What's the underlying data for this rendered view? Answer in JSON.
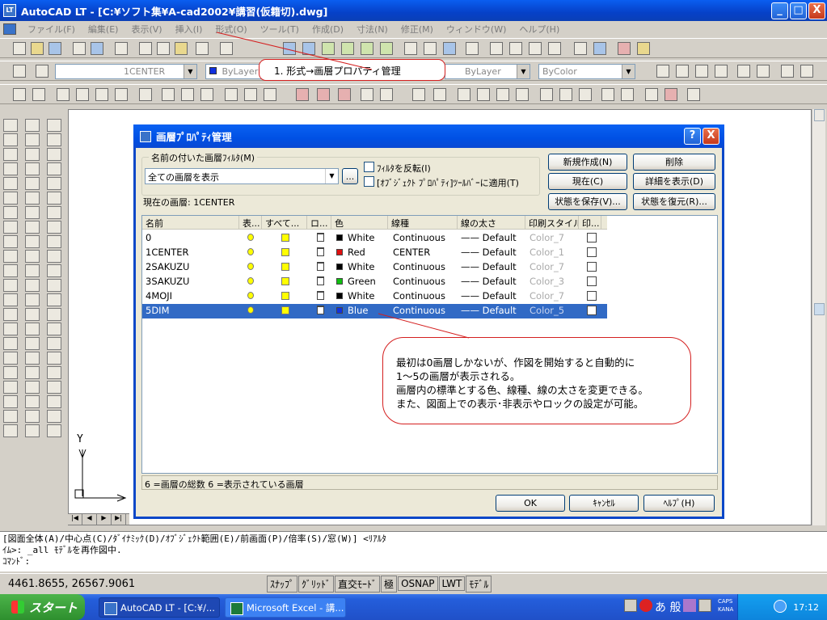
{
  "window": {
    "title": "AutoCAD LT - [C:¥ソフト集¥A-cad2002¥講習(仮籍切).dwg]",
    "controls": [
      "_",
      "□",
      "X"
    ]
  },
  "menubar": [
    "ファイル(F)",
    "編集(E)",
    "表示(V)",
    "挿入(I)",
    "形式(O)",
    "ツール(T)",
    "作成(D)",
    "寸法(N)",
    "修正(M)",
    "ウィンドウ(W)",
    "ヘルプ(H)"
  ],
  "toolbar2": {
    "layer_combo": "1CENTER",
    "color_combo": "ByLayer",
    "linetype_combo": "ByLayer",
    "plotstyle_combo": "ByColor"
  },
  "callout1": {
    "text": "1. 形式→画層プロパティ管理"
  },
  "callout2": {
    "lines": [
      "最初は0画層しかないが、作図を開始すると自動的に",
      "1〜5の画層が表示される。",
      "画層内の標準とする色、線種、線の太さを変更できる。",
      "また、図面上での表示･非表示やロックの設定が可能。"
    ]
  },
  "dialog": {
    "title": "画層ﾌﾟﾛﾊﾟﾃｨ管理",
    "help_btn": "?",
    "close_btn": "X",
    "filter_group_label": "名前の付いた画層ﾌｨﾙﾀ(M)",
    "filter_value": "全ての画層を表示",
    "filter_more": "...",
    "invert_filter": "ﾌｨﾙﾀを反転(I)",
    "apply_toolbar": "[ｵﾌﾞｼﾞｪｸﾄ ﾌﾟﾛﾊﾟﾃｨ]ﾂｰﾙﾊﾞｰに適用(T)",
    "buttons": {
      "new": "新規作成(N)",
      "delete": "削除",
      "current": "現在(C)",
      "show_details": "詳細を表示(D)",
      "save_state": "状態を保存(V)...",
      "restore_state": "状態を復元(R)..."
    },
    "current_layer_label": "現在の画層: 1CENTER",
    "columns": [
      "名前",
      "表...",
      "すべて...",
      "ロ...",
      "色",
      "線種",
      "線の太さ",
      "印刷スタイル",
      "印..."
    ],
    "layers": [
      {
        "name": "0",
        "color_name": "White",
        "color": "#000000",
        "linetype": "Continuous",
        "lineweight": "—— Default",
        "plotstyle": "Color_7"
      },
      {
        "name": "1CENTER",
        "color_name": "Red",
        "color": "#e01010",
        "linetype": "CENTER",
        "lineweight": "—— Default",
        "plotstyle": "Color_1"
      },
      {
        "name": "2SAKUZU",
        "color_name": "White",
        "color": "#000000",
        "linetype": "Continuous",
        "lineweight": "—— Default",
        "plotstyle": "Color_7"
      },
      {
        "name": "3SAKUZU",
        "color_name": "Green",
        "color": "#10c010",
        "linetype": "Continuous",
        "lineweight": "—— Default",
        "plotstyle": "Color_3"
      },
      {
        "name": "4MOJI",
        "color_name": "White",
        "color": "#000000",
        "linetype": "Continuous",
        "lineweight": "—— Default",
        "plotstyle": "Color_7"
      },
      {
        "name": "5DIM",
        "color_name": "Blue",
        "color": "#1030e0",
        "linetype": "Continuous",
        "lineweight": "—— Default",
        "plotstyle": "Color_5"
      }
    ],
    "status_text": "6 =画層の総数 6 =表示されている画層",
    "ok": "OK",
    "cancel": "ｷｬﾝｾﾙ",
    "help": "ﾍﾙﾌﾟ(H)"
  },
  "canvas": {
    "ucs_y": "Y"
  },
  "layout_tabs": [
    "|◀",
    "◀",
    "▶",
    "▶|"
  ],
  "command": {
    "line1": "[図面全体(A)/中心点(C)/ﾀﾞｲﾅﾐｯｸ(D)/ｵﾌﾞｼﾞｪｸﾄ範囲(E)/前画面(P)/倍率(S)/窓(W)] <ﾘｱﾙﾀ",
    "line2": "ｲﾑ>: _all ﾓﾃﾞﾙを再作図中.",
    "line3": "ｺﾏﾝﾄﾞ:"
  },
  "statusbar": {
    "coords": "4461.8655, 26567.9061",
    "toggles": [
      "ｽﾅｯﾌﾟ",
      "ｸﾞﾘｯﾄﾞ",
      "直交ﾓｰﾄﾞ",
      "極",
      "OSNAP",
      "LWT",
      "ﾓﾃﾞﾙ"
    ]
  },
  "taskbar": {
    "start": "スタート",
    "tasks": [
      "AutoCAD LT - [C:¥/...",
      "Microsoft Excel - 講..."
    ],
    "tray_ime": "あ 般",
    "caps": "CAPS",
    "kana": "KANA",
    "clock": "17:12"
  }
}
